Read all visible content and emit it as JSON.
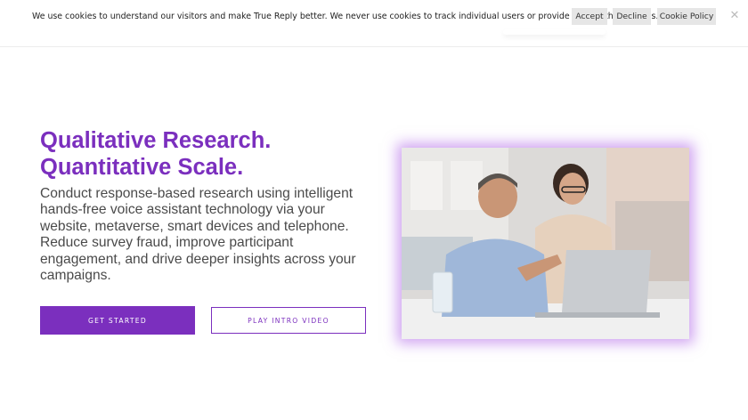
{
  "cookie_banner": {
    "message": "We use cookies to understand our visitors and make True Reply better. We never use cookies to track individual users or provide data to third parties.",
    "accept_label": "Accept",
    "decline_label": "Decline",
    "policy_label": "Cookie Policy",
    "close_icon": "close-icon"
  },
  "hero": {
    "title_line1": "Qualitative Research.",
    "title_line2": "Quantitative Scale.",
    "description": "Conduct response-based research using intelligent hands-free voice assistant technology via your website, metaverse, smart devices and telephone. Reduce survey fraud, improve participant engagement, and drive deeper insights across your campaigns.",
    "primary_cta": "GET STARTED",
    "secondary_cta": "PLAY INTRO VIDEO",
    "image_subject": "hero-photo"
  },
  "colors": {
    "brand_purple": "#7b2fbe",
    "cookie_button_bg": "#e6e6e6",
    "text": "#4a4a4a"
  }
}
